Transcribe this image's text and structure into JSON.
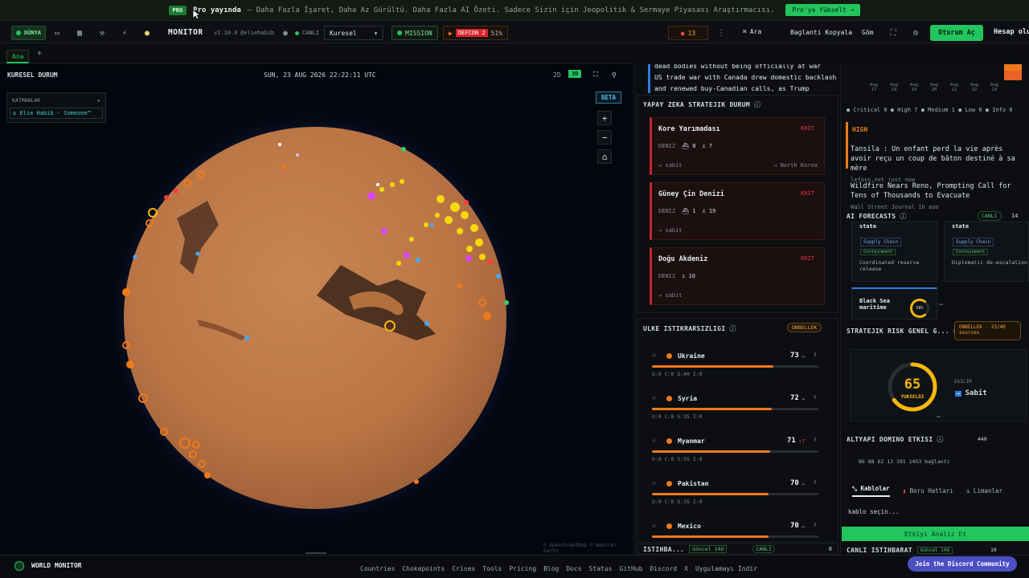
{
  "promo": {
    "badge": "PRO",
    "strong": "Pro yayında",
    "text": "— Daha Fazla İşaret, Daha Az Gürültü. Daha Fazla AI Özeti. Sadece Sizin için Jeopolitik & Sermaye Piyasası Araştırmacısı.",
    "button": "Pro'ya Yükselt →"
  },
  "nav": {
    "variant_label": "DÜNYA",
    "brand": "MONITOR",
    "version": "v2.10.0",
    "handle": "@eliehabib",
    "live": "CANLI",
    "region": "Kuresel",
    "mission": "MISSION",
    "defcon_label": "DEFCON 2",
    "defcon_pct": "51%",
    "alert_count": "13",
    "search": "Ara",
    "copy_link": "Baglanti Kopyala",
    "embed": "Göm",
    "signin": "Oturum Aç",
    "account": "Hesap oluş"
  },
  "tabs": {
    "active": "Ana",
    "add": "+"
  },
  "map": {
    "title": "KURESEL DURUM",
    "datetime": "SUN, 23 AUG 2026 22:22:11 UTC",
    "mode_2d": "2D",
    "mode_3d": "3D",
    "layers_title": "KATMANLAR",
    "layers_item": "Elie Habib · Someone™",
    "beta": "BETA",
    "zoom_in": "+",
    "zoom_out": "−",
    "home": "⌂",
    "credit": "© OpenStreetMap © Natural Earth"
  },
  "news_top": {
    "line1": "dead bodies without being officially at war",
    "line2": "US trade war with Canada drew domestic backlash",
    "line3": "and renewed buy-Canadian calls",
    "line3b": ", as Trump"
  },
  "ai_strategic": {
    "title": "YAPAY ZEKA STRATEJIK DURUM",
    "cards": [
      {
        "name": "Kore Yarımadası",
        "tag": "KRİT",
        "sub": "DENIZ",
        "a": "8",
        "b": "7",
        "trend": "→ sabit",
        "region": "→ North Korea"
      },
      {
        "name": "Güney Çin Denizi",
        "tag": "KRİT",
        "sub": "DENIZ",
        "a": "1",
        "b": "19",
        "trend": "→ sabit",
        "region": ""
      },
      {
        "name": "Doğu Akdeniz",
        "tag": "KRİT",
        "sub": "DENIZ",
        "a": "",
        "b": "10",
        "trend": "→ sabit",
        "region": ""
      }
    ]
  },
  "instability": {
    "title": "ULKE ISTIKRARSIZLIGI",
    "badge": "ONBELLEK",
    "rows": [
      {
        "name": "Ukraine",
        "score": "73",
        "arrow": "→",
        "sub": "U:0 C:0 S:40 I:0",
        "pct": 0.73
      },
      {
        "name": "Syria",
        "score": "72",
        "arrow": "→",
        "sub": "U:0 C:0 S:35 I:0",
        "pct": 0.72
      },
      {
        "name": "Myanmar",
        "score": "71",
        "arrow": "↑7",
        "sub": "U:0 C:0 S:55 I:0",
        "pct": 0.71
      },
      {
        "name": "Pakistan",
        "score": "70",
        "arrow": "→",
        "sub": "U:0 C:0 S:35 I:0",
        "pct": 0.7
      },
      {
        "name": "Mexico",
        "score": "70",
        "arrow": "→",
        "sub": "",
        "pct": 0.7
      }
    ]
  },
  "intel_bar": {
    "title": "ISTIHBA...",
    "updated": "Güncel 14d",
    "live": "CANLI",
    "count": "0"
  },
  "far_right": {
    "chart_dates": [
      "Aug 17",
      "Aug 18",
      "Aug 19",
      "Aug 20",
      "Aug 21",
      "Aug 22",
      "Aug 23"
    ],
    "severity": "● Critical 0  ● High 7  ● Medium 1  ● Low 0  ● Info 0",
    "high_label": "HIGH",
    "news": [
      {
        "title": "Tansila : Un enfant perd la vie après avoir reçu un coup de bâton destiné à sa mère",
        "src": "lefaso.net   just now"
      },
      {
        "title": "Wildfire Nears Reno, Prompting Call for Tens of Thousands to Evacuate",
        "src": "Wall Street Journal  1h ago"
      }
    ],
    "forecasts_title": "AI FORECASTS",
    "forecasts_live": "CANLI",
    "forecasts_count": "14",
    "forecast_cards": [
      {
        "head": "state",
        "tag1": "Supply Chain",
        "tag2": "Containment",
        "desc": "Coordinated reserve release"
      },
      {
        "head": "state",
        "tag1": "Supply Chain",
        "tag2": "Containment",
        "desc": "Diplomatic de-escalation"
      }
    ],
    "black_sea": "Black Sea maritime",
    "black_sea_pct": "58%",
    "risk_title": "STRATEJIK RISK GENEL G...",
    "risk_badge": "ONBELLEK · 23/40 sources",
    "risk_score": "65",
    "risk_label": "YUKSELDI",
    "trend_label": "EGILIM",
    "trend_value": "Sabit",
    "domino_title": "ALTYAPI DOMINO ETKISI",
    "domino_count": "440",
    "domino_stats": "86   88   62   13   191   1453 bağlantı",
    "domino_tabs": [
      "Kablolar",
      "Boru Hatları",
      "Limanlar"
    ],
    "select_hint": "kablo seçin...",
    "analyze": "Etkiyi Analiz Et",
    "live_intel": "CANLI ISTIHBARAT",
    "live_intel_updated": "Güncel 14d",
    "live_intel_count": "10"
  },
  "footer": {
    "brand": "WORLD MONITOR",
    "links": [
      "Countries",
      "Chokepoints",
      "Crises",
      "Tools",
      "Pricing",
      "Blog",
      "Docs",
      "Status",
      "GitHub",
      "Discord",
      "X",
      "Uygulamayı İndir"
    ],
    "discord": "Join the Discord Community"
  },
  "colors": {
    "accent": "#22c55e",
    "critical": "#c8262d",
    "orange": "#f07a1b",
    "globe": "#c27a4a"
  }
}
